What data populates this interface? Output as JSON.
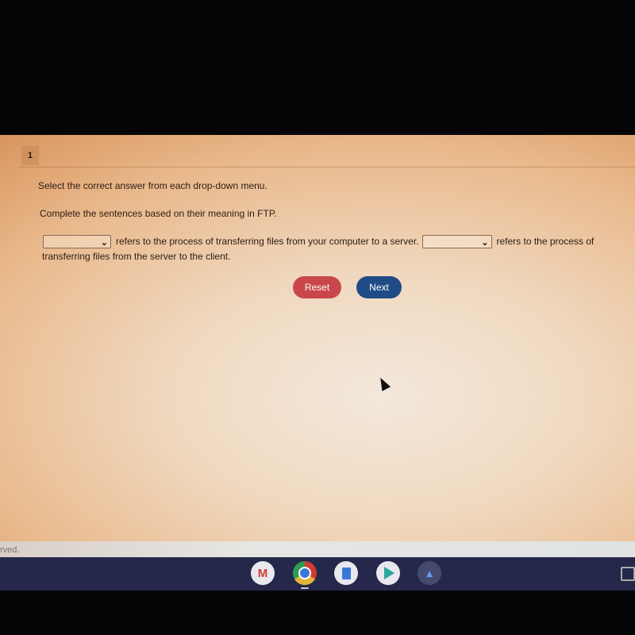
{
  "question": {
    "number": "1",
    "instruction": "Select the correct answer from each drop-down menu.",
    "prompt": "Complete the sentences based on their meaning in FTP.",
    "sentence_part1": "refers to the process of transferring files from your computer to a server.",
    "sentence_part2": "refers to the process of",
    "sentence_part3": "transferring files from the server to the client.",
    "dropdowns": [
      {
        "selected": "",
        "icon": "chevron-down-icon"
      },
      {
        "selected": "",
        "icon": "chevron-down-icon"
      }
    ]
  },
  "buttons": {
    "reset_label": "Reset",
    "next_label": "Next",
    "reset_color": "#c9474a",
    "next_color": "#1f4c86"
  },
  "footer": {
    "text": "rved."
  },
  "shelf": {
    "apps": [
      {
        "name": "Gmail",
        "icon": "gmail-icon",
        "glyph": "M"
      },
      {
        "name": "Chrome",
        "icon": "chrome-icon"
      },
      {
        "name": "Docs",
        "icon": "docs-icon"
      },
      {
        "name": "Play Store",
        "icon": "play-store-icon"
      },
      {
        "name": "Photos",
        "icon": "photos-icon",
        "glyph": "▲"
      }
    ]
  }
}
